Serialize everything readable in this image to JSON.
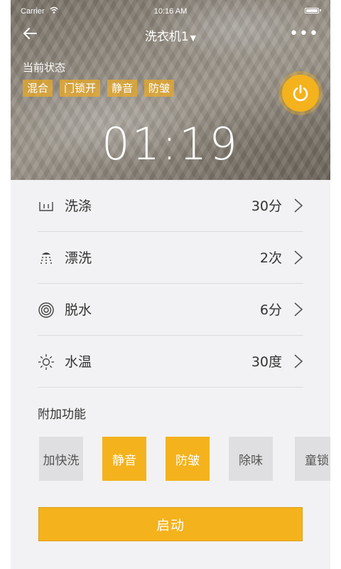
{
  "status_bar": {
    "carrier": "Carrier",
    "time": "10:16 AM",
    "wifi_icon": "wifi-icon",
    "battery_icon": "battery-icon"
  },
  "nav": {
    "title": "洗衣机1",
    "caret": "▼",
    "back_icon": "back-arrow-icon",
    "more_icon": "more-icon",
    "more_glyph": "•••"
  },
  "state": {
    "label": "当前状态",
    "tags": [
      "混合",
      "门锁开",
      "静音",
      "防皱"
    ],
    "power_icon": "power-icon",
    "timer": "01:19"
  },
  "settings": [
    {
      "icon": "wash-basin-icon",
      "label": "洗涤",
      "value": "30分"
    },
    {
      "icon": "rinse-shower-icon",
      "label": "漂洗",
      "value": "2次"
    },
    {
      "icon": "spin-spiral-icon",
      "label": "脱水",
      "value": "6分"
    },
    {
      "icon": "sun-temperature-icon",
      "label": "水温",
      "value": "30度"
    }
  ],
  "extras": {
    "title": "附加功能",
    "options": [
      {
        "label": "加快洗",
        "active": false
      },
      {
        "label": "静音",
        "active": true
      },
      {
        "label": "防皱",
        "active": true
      },
      {
        "label": "除味",
        "active": false
      },
      {
        "label": "童锁",
        "active": false
      }
    ]
  },
  "start_button": {
    "label": "启动"
  },
  "colors": {
    "accent": "#f4b21c",
    "chip_inactive": "#dfdfe1",
    "background": "#f2f2f4"
  }
}
